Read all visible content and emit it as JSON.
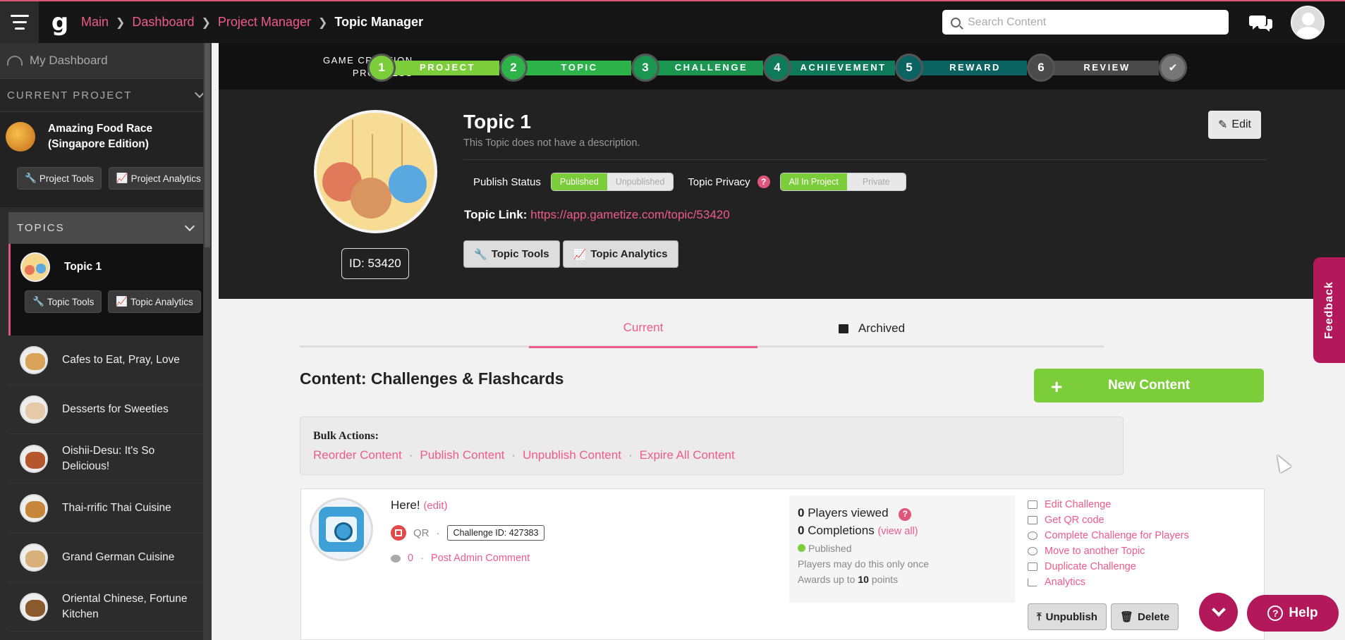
{
  "topbar": {
    "breadcrumbs": [
      "Main",
      "Dashboard",
      "Project Manager"
    ],
    "current": "Topic Manager",
    "search_placeholder": "Search Content",
    "accent_color": "#e0567b"
  },
  "sidebar": {
    "my_dashboard": "My Dashboard",
    "current_project_header": "CURRENT PROJECT",
    "project_name": "Amazing Food Race (Singapore Edition)",
    "project_tools": "Project Tools",
    "project_analytics": "Project Analytics",
    "topics_header": "TOPICS",
    "active_topic": "Topic 1",
    "topic_tools": "Topic Tools",
    "topic_analytics": "Topic Analytics",
    "topics": [
      "Cafes to Eat, Pray, Love",
      "Desserts for Sweeties",
      "Oishii-Desu: It's So Delicious!",
      "Thai-rrific Thai Cuisine",
      "Grand German Cuisine",
      "Oriental Chinese, Fortune Kitchen"
    ]
  },
  "progress": {
    "label_line1": "GAME CREATION",
    "label_line2": "PROGRESS",
    "steps": [
      {
        "num": "1",
        "label": "PROJECT",
        "color": "#7ccd3a"
      },
      {
        "num": "2",
        "label": "TOPIC",
        "color": "#2db34a"
      },
      {
        "num": "3",
        "label": "CHALLENGE",
        "color": "#1a9650"
      },
      {
        "num": "4",
        "label": "ACHIEVEMENT",
        "color": "#0f7a5a"
      },
      {
        "num": "5",
        "label": "REWARD",
        "color": "#0a6360"
      },
      {
        "num": "6",
        "label": "REVIEW",
        "color": "#4a4a4a"
      }
    ],
    "done_icon": "check-icon"
  },
  "topic": {
    "title": "Topic 1",
    "description": "This Topic does not have a description.",
    "edit_label": "Edit",
    "id_label": "ID: 53420",
    "publish_status_label": "Publish Status",
    "published": "Published",
    "unpublished": "Unpublished",
    "privacy_label": "Topic Privacy",
    "all_in_project": "All In Project",
    "private": "Private",
    "link_label": "Topic Link:",
    "link_url": "https://app.gametize.com/topic/53420",
    "tools_label": "Topic Tools",
    "analytics_label": "Topic Analytics"
  },
  "tabs": {
    "current": "Current",
    "archived": "Archived"
  },
  "content": {
    "title": "Content: Challenges & Flashcards",
    "new_content": "New Content",
    "bulk_title": "Bulk Actions:",
    "bulk_actions": [
      "Reorder Content",
      "Publish Content",
      "Unpublish Content",
      "Expire All Content"
    ]
  },
  "challenge": {
    "title": "Here!",
    "edit_link": "(edit)",
    "type": "QR",
    "id_label": "Challenge ID: 427383",
    "comments_count": "0",
    "post_comment": "Post Admin Comment",
    "players_viewed_num": "0",
    "players_viewed_text": "Players viewed",
    "completions_num": "0",
    "completions_text": "Completions",
    "view_all": "(view all)",
    "status": "Published",
    "limit_text": "Players may do this only once",
    "awards_prefix": "Awards up to",
    "awards_points": "10",
    "awards_suffix": "points",
    "actions": [
      "Edit Challenge",
      "Get QR code",
      "Complete Challenge for Players",
      "Move to another Topic",
      "Duplicate Challenge",
      "Analytics"
    ],
    "unpublish": "Unpublish",
    "delete": "Delete"
  },
  "floating": {
    "help": "Help",
    "feedback": "Feedback"
  }
}
